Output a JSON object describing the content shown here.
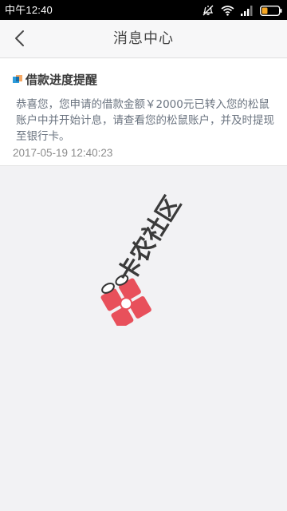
{
  "status_bar": {
    "time": "中午12:40"
  },
  "header": {
    "title": "消息中心"
  },
  "message": {
    "title": "借款进度提醒",
    "body": "恭喜您，您申请的借款金额￥2000元已转入您的松鼠账户中并开始计息，请查看您的松鼠账户，并及时提现至银行卡。",
    "timestamp": "2017-05-19 12:40:23"
  },
  "watermark": {
    "text": "卡农社区"
  }
}
